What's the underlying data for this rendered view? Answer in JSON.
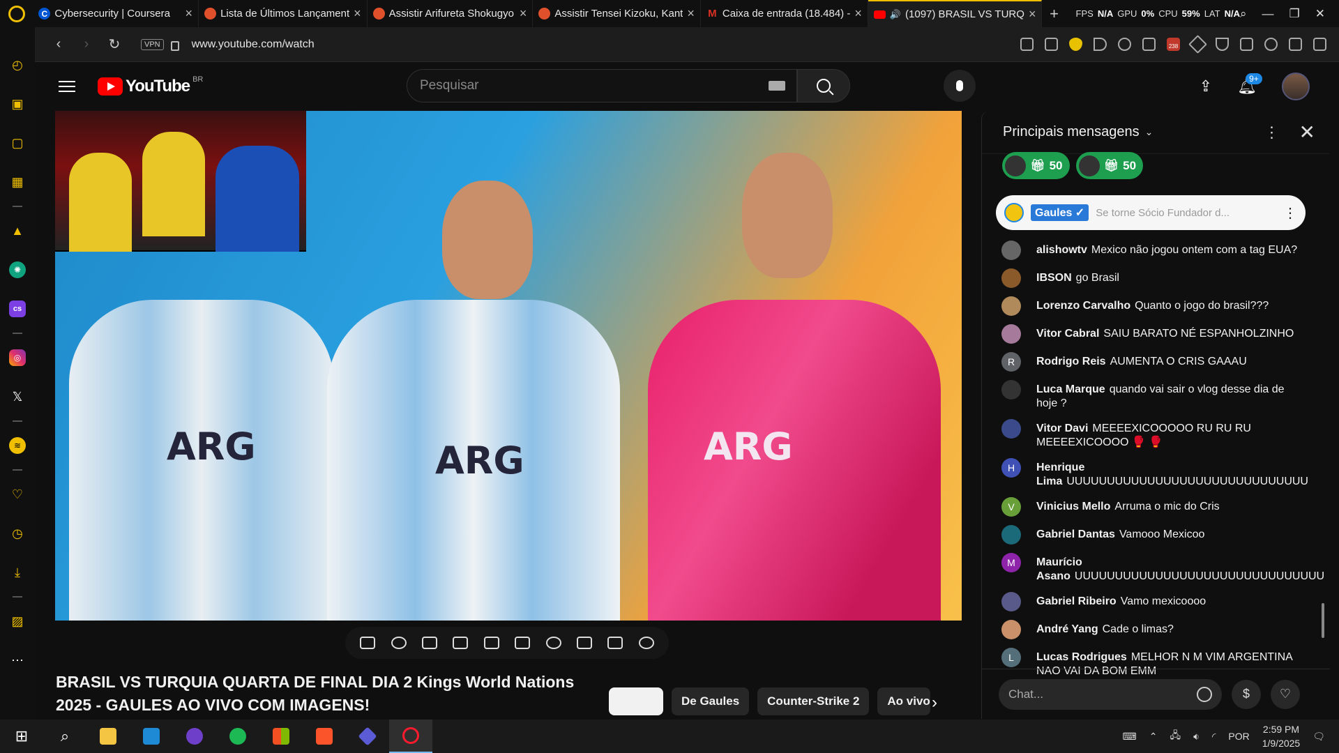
{
  "browser": {
    "tabs": [
      {
        "title": "Cybersecurity | Coursera",
        "icon": "coursera-icon",
        "color": "#0056d2"
      },
      {
        "title": "Lista de Últimos Lançament",
        "icon": "anime-site-icon",
        "color": "#e0512b"
      },
      {
        "title": "Assistir Arifureta Shokugyo",
        "icon": "anime-site-icon",
        "color": "#e0512b"
      },
      {
        "title": "Assistir Tensei Kizoku, Kant",
        "icon": "anime-site-icon",
        "color": "#e0512b"
      },
      {
        "title": "Caixa de entrada (18.484) -",
        "icon": "gmail-icon",
        "color": "#d93025"
      },
      {
        "title": "(1097) BRASIL VS TURQ",
        "icon": "youtube-icon",
        "color": "#ff0000"
      }
    ],
    "new_tab": "+",
    "stats": {
      "fps_label": "FPS",
      "fps": "N/A",
      "gpu_label": "GPU",
      "gpu": "0%",
      "cpu_label": "CPU",
      "cpu": "59%",
      "lat_label": "LAT",
      "lat": "N/A"
    },
    "url": "www.youtube.com/watch",
    "vpn_label": "VPN",
    "ext_badge": "238"
  },
  "youtube": {
    "logo_text": "YouTube",
    "country": "BR",
    "search_placeholder": "Pesquisar",
    "notif_count": "9+",
    "video_title": "BRASIL VS TURQUIA QUARTA DE FINAL DIA 2 Kings World Nations 2025 - GAULES AO VIVO COM IMAGENS!",
    "chips": [
      "",
      "De Gaules",
      "Counter-Strike 2",
      "Ao vivo"
    ],
    "jersey_text": "ARG"
  },
  "chat": {
    "header": "Principais mensagens",
    "gifts": [
      {
        "count": "50"
      },
      {
        "count": "50"
      }
    ],
    "pinned": {
      "name": "Gaules ✓",
      "text": "Se torne Sócio Fundador d..."
    },
    "messages": [
      {
        "user": "alishowtv",
        "text": "Mexico não jogou ontem com a tag EUA?",
        "avatar": "",
        "color": "#666"
      },
      {
        "user": "IBSON",
        "text": "go Brasil",
        "avatar": "",
        "color": "#8b5a2b"
      },
      {
        "user": "Lorenzo Carvalho",
        "text": "Quanto o jogo do brasil???",
        "avatar": "",
        "color": "#b08a5a"
      },
      {
        "user": "Vitor Cabral",
        "text": "SAIU BARATO NÉ ESPANHOLZINHO",
        "avatar": "",
        "color": "#a57a9a"
      },
      {
        "user": "Rodrigo Reis",
        "text": "AUMENTA O CRIS GAAAU",
        "avatar": "R",
        "color": "#5f6368"
      },
      {
        "user": "Luca Marque",
        "text": "quando vai sair o vlog desse dia de hoje ?",
        "avatar": "",
        "color": "#333"
      },
      {
        "user": "Vitor Davi",
        "text": "MEEEEXICOOOOO RU RU RU MEEEEXICOOOO 🥊 🥊",
        "avatar": "",
        "color": "#3a4a8a"
      },
      {
        "user": "Henrique Lima",
        "text": "UUUUUUUUUUUUUUUUUUUUUUUUUUUUUU",
        "avatar": "H",
        "color": "#3f51b5"
      },
      {
        "user": "Vinicius Mello",
        "text": "Arruma o mic do Cris",
        "avatar": "V",
        "color": "#689f38"
      },
      {
        "user": "Gabriel Dantas",
        "text": "Vamooo Mexicoo",
        "avatar": "",
        "color": "#1b6a7a"
      },
      {
        "user": "Maurício Asano",
        "text": "UUUUUUUUUUUUUUUUUUUUUUUUUUUUUUU",
        "avatar": "M",
        "color": "#8e24aa"
      },
      {
        "user": "Gabriel Ribeiro",
        "text": "Vamo mexicoooo",
        "avatar": "",
        "color": "#5a5a8a"
      },
      {
        "user": "André Yang",
        "text": "Cade o limas?",
        "avatar": "",
        "color": "#c9906a"
      },
      {
        "user": "Lucas Rodrigues",
        "text": "MELHOR N M VIM ARGENTINA NAO VAI DA BOM EMM",
        "avatar": "L",
        "color": "#546e7a"
      }
    ],
    "input_placeholder": "Chat..."
  },
  "taskbar": {
    "lang": "POR",
    "time": "2:59 PM",
    "date": "1/9/2025"
  }
}
